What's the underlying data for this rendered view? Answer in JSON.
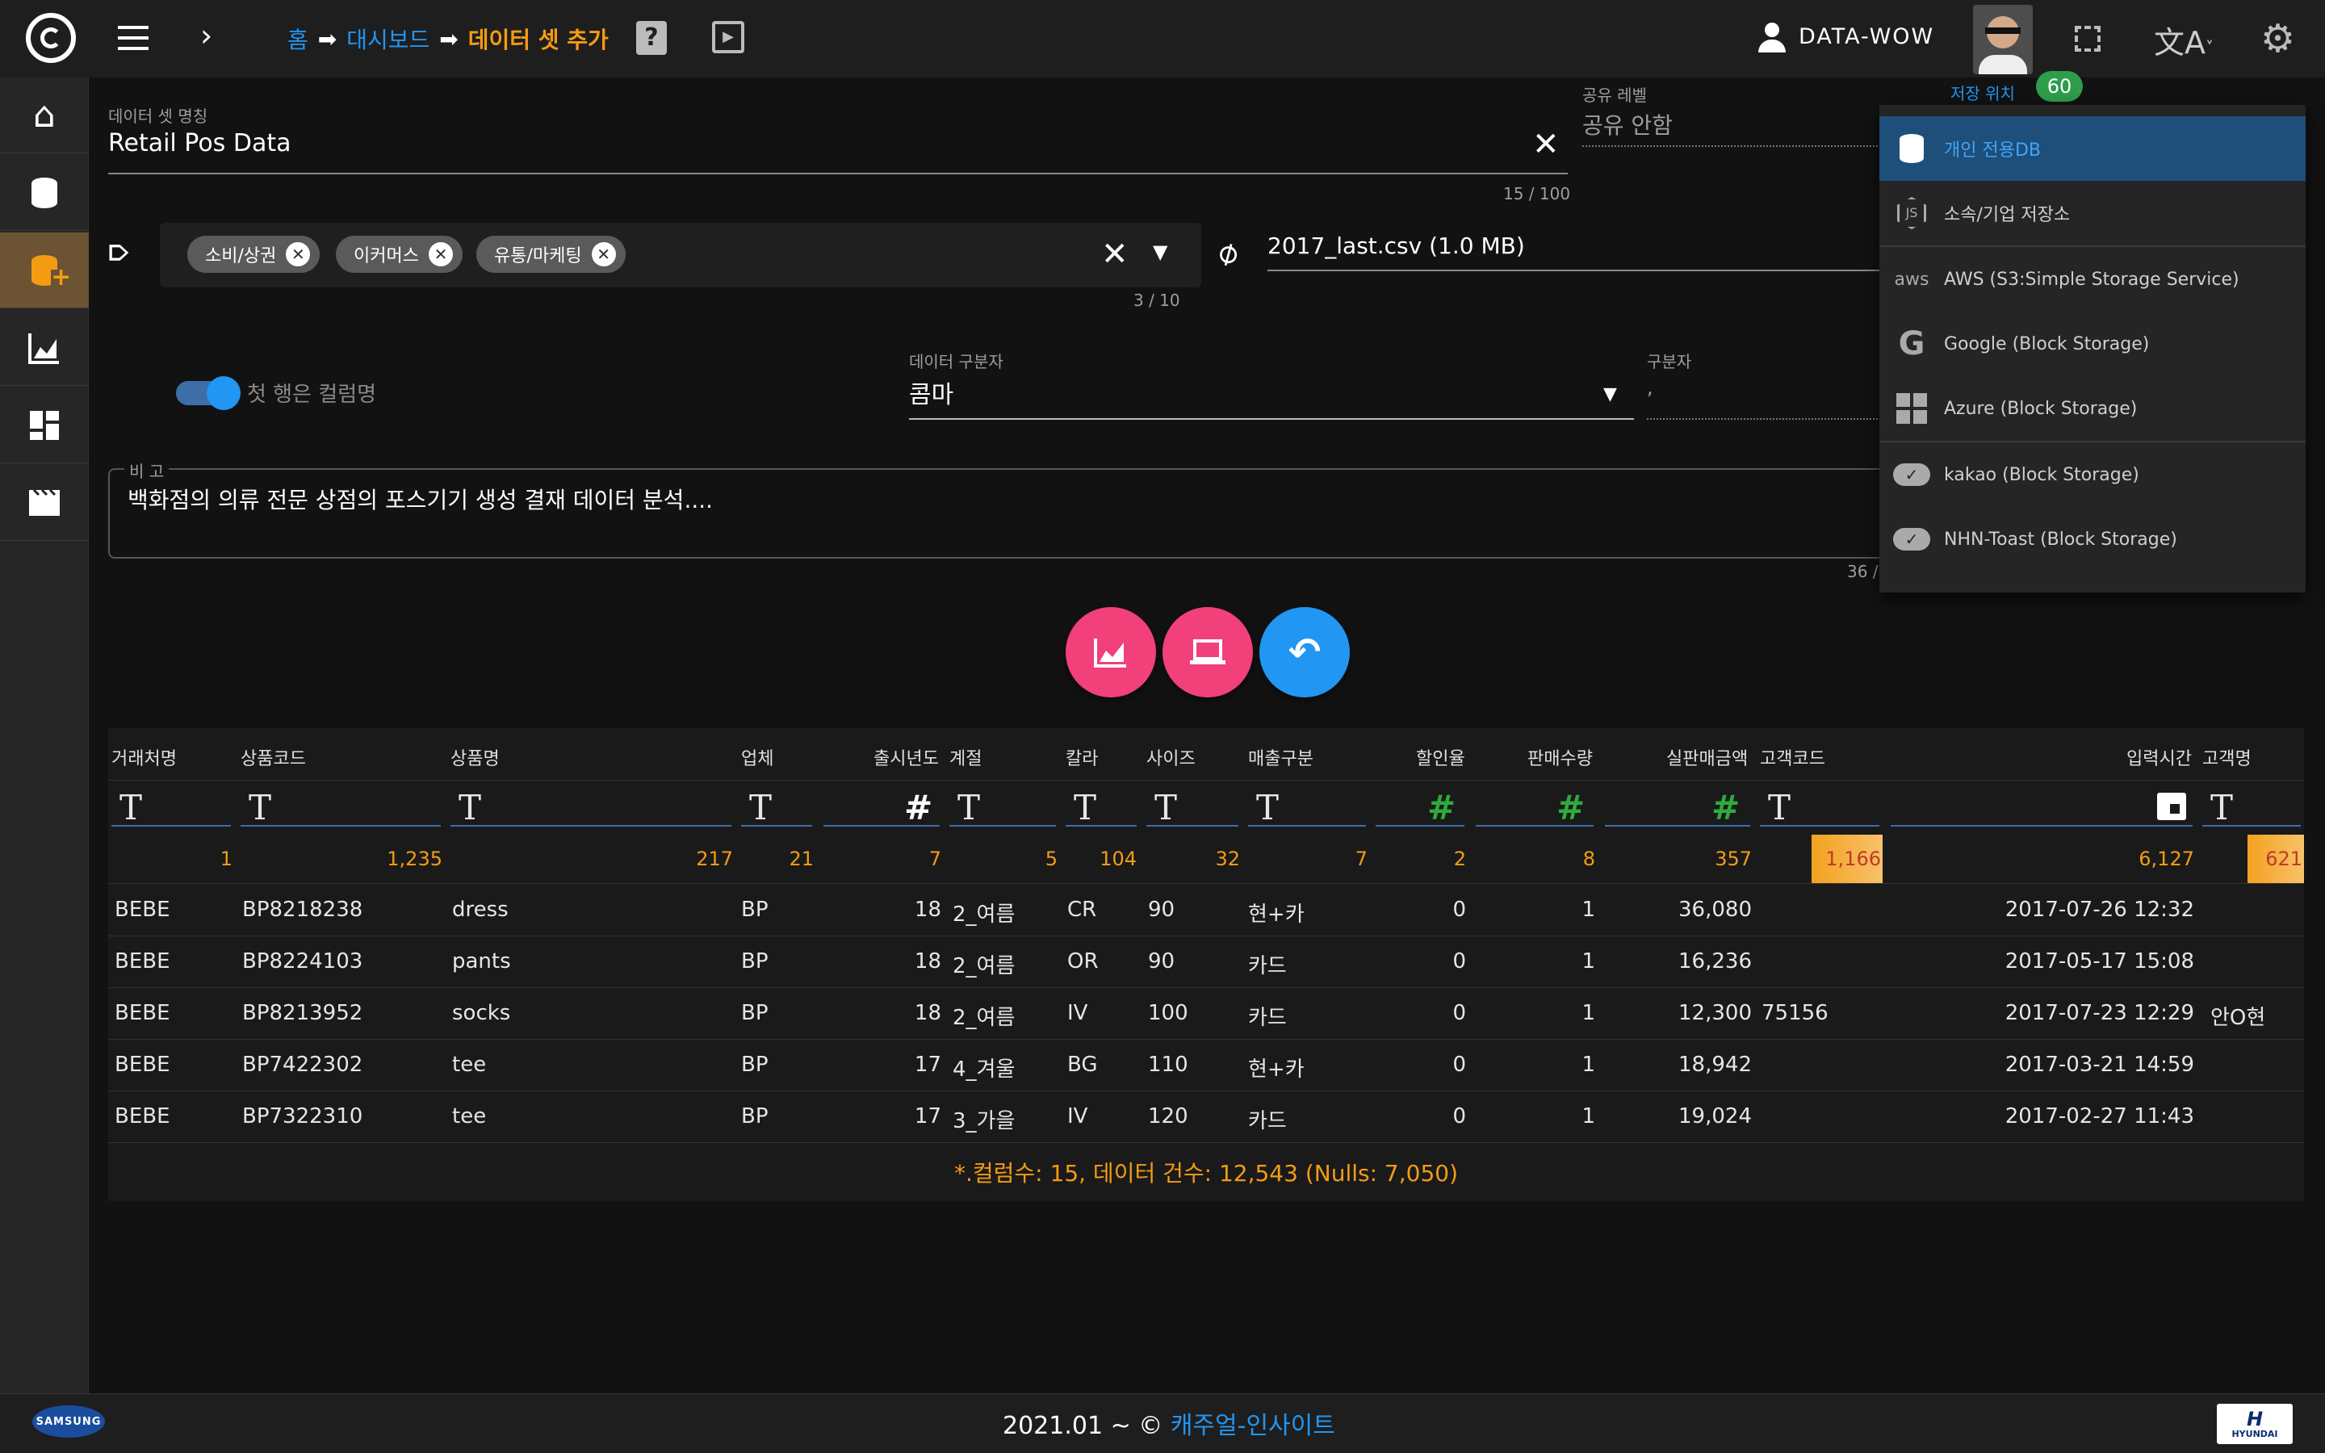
{
  "header": {
    "breadcrumb": [
      "홈",
      "대시보드",
      "데이터 셋 추가"
    ],
    "user": "DATA-WOW",
    "badge_count": "60",
    "storage_label": "저장 위치"
  },
  "form": {
    "name_label": "데이터 셋 명칭",
    "name_value": "Retail Pos Data",
    "name_counter": "15 / 100",
    "share_label": "공유 레벨",
    "share_value": "공유 안함",
    "tags": [
      "소비/상권",
      "이커머스",
      "유통/마케팅"
    ],
    "tags_counter": "3 / 10",
    "file_value": "2017_last.csv (1.0 MB)",
    "toggle_label": "첫 행은 컬럼명",
    "delimiter_label": "데이터 구분자",
    "delimiter_value": "콤마",
    "separator_label": "구분자",
    "separator_value": ",",
    "note_label": "비 고",
    "note_value": "백화점의 의류 전문 상점의 포스기기 생성 결재 데이터 분석....",
    "note_counter": "36 /"
  },
  "storage_options": [
    {
      "label": "개인 전용DB",
      "icon": "database-lock-icon",
      "selected": true
    },
    {
      "label": "소속/기업 저장소",
      "icon": "nodejs-icon",
      "selected": false
    },
    {
      "label": "AWS (S3:Simple Storage Service)",
      "icon": "aws-icon",
      "selected": false
    },
    {
      "label": "Google (Block Storage)",
      "icon": "google-icon",
      "selected": false
    },
    {
      "label": "Azure (Block Storage)",
      "icon": "windows-icon",
      "selected": false
    },
    {
      "label": "kakao (Block Storage)",
      "icon": "cloud-check-icon",
      "selected": false
    },
    {
      "label": "NHN-Toast (Block Storage)",
      "icon": "cloud-check-icon",
      "selected": false
    }
  ],
  "table": {
    "columns": [
      "거래처명",
      "상품코드",
      "상품명",
      "업체",
      "출시년도",
      "계절",
      "칼라",
      "사이즈",
      "매출구분",
      "할인율",
      "판매수량",
      "실판매금액",
      "고객코드",
      "입력시간",
      "고객명"
    ],
    "types": [
      "T",
      "T",
      "T",
      "T",
      "#",
      "T",
      "T",
      "T",
      "T",
      "#",
      "#",
      "#",
      "T",
      "date",
      "T"
    ],
    "uniques": [
      "1",
      "1,235",
      "217",
      "21",
      "7",
      "5",
      "104",
      "32",
      "7",
      "2",
      "8",
      "357",
      "1,166",
      "6,127",
      "621"
    ],
    "rows": [
      [
        "BEBE",
        "BP8218238",
        "dress",
        "BP",
        "18",
        "2_여름",
        "CR",
        "90",
        "현+카",
        "0",
        "1",
        "36,080",
        "",
        "2017-07-26 12:32",
        ""
      ],
      [
        "BEBE",
        "BP8224103",
        "pants",
        "BP",
        "18",
        "2_여름",
        "OR",
        "90",
        "카드",
        "0",
        "1",
        "16,236",
        "",
        "2017-05-17 15:08",
        ""
      ],
      [
        "BEBE",
        "BP8213952",
        "socks",
        "BP",
        "18",
        "2_여름",
        "IV",
        "100",
        "카드",
        "0",
        "1",
        "12,300",
        "75156",
        "2017-07-23 12:29",
        "안O현"
      ],
      [
        "BEBE",
        "BP7422302",
        "tee",
        "BP",
        "17",
        "4_겨울",
        "BG",
        "110",
        "현+카",
        "0",
        "1",
        "18,942",
        "",
        "2017-03-21 14:59",
        ""
      ],
      [
        "BEBE",
        "BP7322310",
        "tee",
        "BP",
        "17",
        "3_가을",
        "IV",
        "120",
        "카드",
        "0",
        "1",
        "19,024",
        "",
        "2017-02-27 11:43",
        ""
      ]
    ],
    "summary": "*.컬럼수: 15, 데이터 건수: 12,543 (Nulls: 7,050)"
  },
  "footer": {
    "copyright": "2021.01 ~ ©",
    "brand": "캐주얼-인사이트",
    "left_logo": "SAMSUNG",
    "right_logo": "HYUNDAI"
  },
  "colors": {
    "accent": "#f39c12",
    "link": "#2196f3",
    "pink": "#f2407a",
    "blue": "#2196f3",
    "selected": "#1e4e7a"
  }
}
